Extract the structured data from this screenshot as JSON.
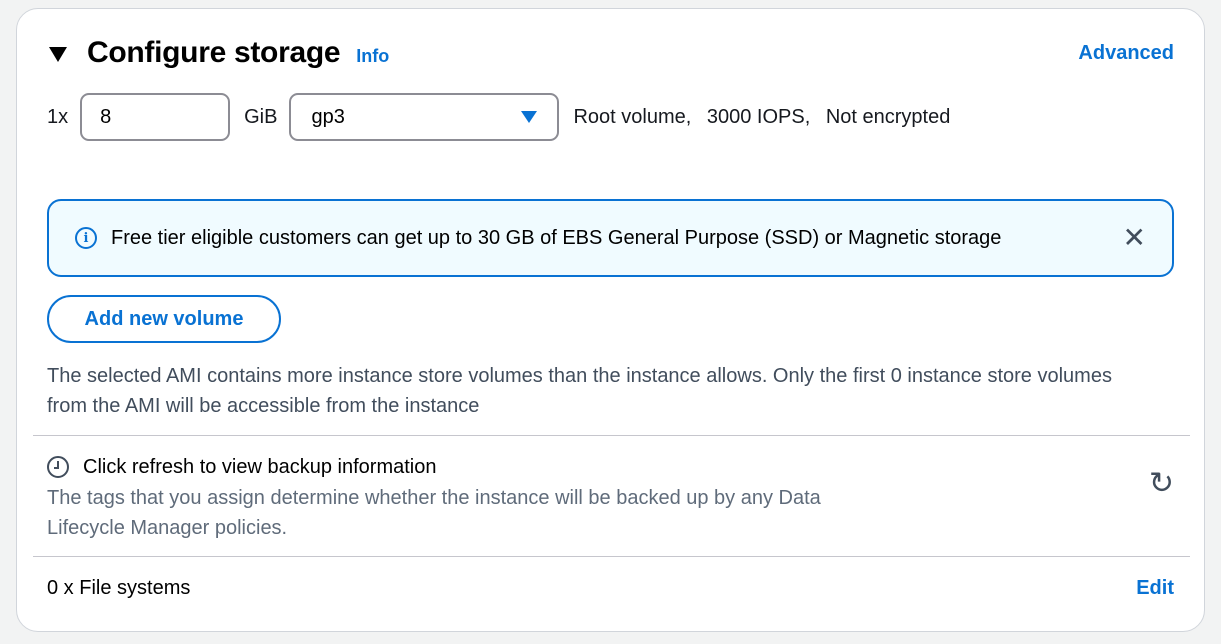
{
  "header": {
    "title": "Configure storage",
    "info_label": "Info",
    "advanced_label": "Advanced"
  },
  "volume": {
    "count_label": "1x",
    "size_value": "8",
    "unit_label": "GiB",
    "type_selected": "gp3",
    "description": [
      "Root volume,",
      "3000 IOPS,",
      "Not encrypted"
    ]
  },
  "alert": {
    "text": "Free tier eligible customers can get up to 30 GB of EBS General Purpose (SSD) or Magnetic storage"
  },
  "add_volume_label": "Add new volume",
  "ami_note": "The selected AMI contains more instance store volumes than the instance allows. Only the first 0 instance store volumes from the AMI will be accessible from the instance",
  "backup": {
    "title": "Click refresh to view backup information",
    "description": "The tags that you assign determine whether the instance will be backed up by any Data Lifecycle Manager policies."
  },
  "file_systems": {
    "label": "0 x File systems",
    "edit_label": "Edit"
  },
  "icons": [
    "caret-down-icon",
    "info-icon",
    "close-icon",
    "clock-icon",
    "refresh-icon"
  ],
  "colors": {
    "accent": "#0972d3",
    "alert_background": "#f0fbff"
  }
}
